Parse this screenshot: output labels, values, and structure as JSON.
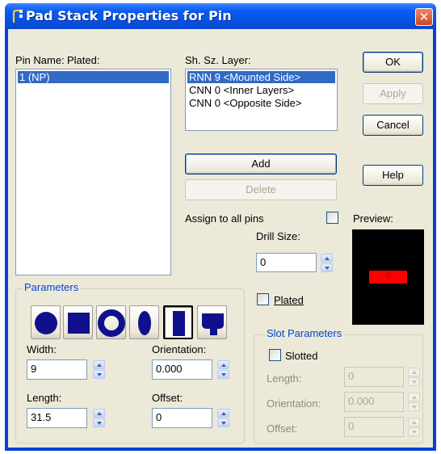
{
  "window": {
    "title": "Pad Stack Properties for Pin",
    "close_glyph": "✕"
  },
  "pin_list": {
    "header_name": "Pin Name:",
    "header_plated": "Plated:",
    "items": [
      "1 (NP)"
    ],
    "selected_index": 0
  },
  "layer_list": {
    "header": "Sh. Sz. Layer:",
    "items": [
      "RNN 9 <Mounted Side>",
      "CNN 0 <Inner Layers>",
      "CNN 0 <Opposite Side>"
    ],
    "selected_index": 0
  },
  "buttons": {
    "ok": "OK",
    "apply": "Apply",
    "cancel": "Cancel",
    "help": "Help",
    "add": "Add",
    "delete": "Delete"
  },
  "assign_all_pins": {
    "label": "Assign to all pins",
    "checked": false
  },
  "preview": {
    "label": "Preview:",
    "pad_color": "#ff0000",
    "background": "#000000",
    "marker": "+"
  },
  "drill": {
    "label": "Drill Size:",
    "value": "0"
  },
  "plated": {
    "label": "Plated",
    "checked": false
  },
  "parameters": {
    "title": "Parameters",
    "shapes": [
      "round-pad-icon",
      "square-pad-icon",
      "annular-ring-icon",
      "oval-pad-icon",
      "rectangle-pad-icon",
      "custom-pad-icon"
    ],
    "selected_shape_index": 4,
    "width_label": "Width:",
    "width_value": "9",
    "orientation_label": "Orientation:",
    "orientation_value": "0.000",
    "length_label": "Length:",
    "length_value": "31.5",
    "offset_label": "Offset:",
    "offset_value": "0"
  },
  "slot": {
    "title": "Slot Parameters",
    "slotted_label": "Slotted",
    "slotted_checked": false,
    "length_label": "Length:",
    "length_value": "0",
    "orientation_label": "Orientation:",
    "orientation_value": "0.000",
    "offset_label": "Offset:",
    "offset_value": "0"
  },
  "colors": {
    "accent": "#0046d5",
    "title_bar": "#0a5bf0",
    "selection": "#316ac5",
    "shape_fill": "#10108c"
  }
}
